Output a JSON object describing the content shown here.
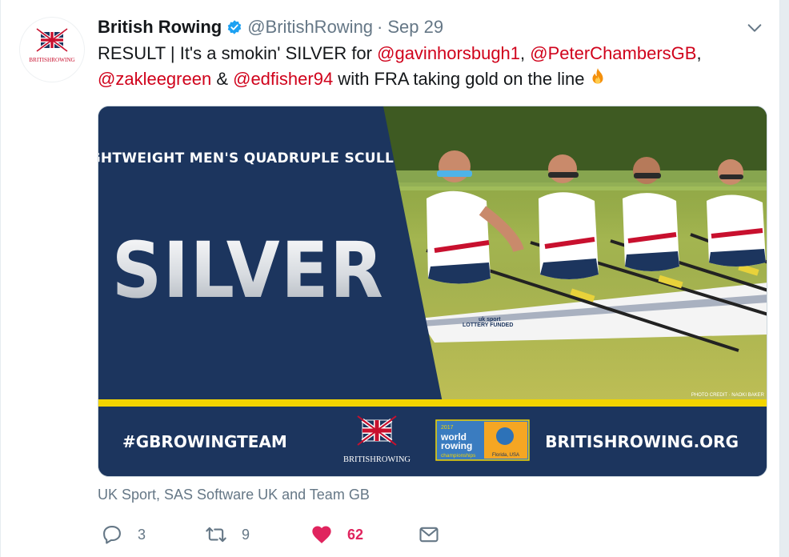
{
  "tweet": {
    "author_name": "British Rowing",
    "handle": "@BritishRowing",
    "separator": "·",
    "time": "Sep 29",
    "text_parts": {
      "p1": "RESULT | It's a smokin' SILVER for ",
      "m1": "@gavinhorsbugh1",
      "p2": ", ",
      "m2": "@PeterChambersGB",
      "p3": ",",
      "m3": "@zakleegreen",
      "p4": " & ",
      "m4": "@edfisher94",
      "p5": " with FRA taking gold on the line"
    },
    "avatar_logo_text": "BRITISHROWING"
  },
  "media": {
    "event_title": "LIGHTWEIGHT MEN'S QUADRUPLE SCULL",
    "medal_text": "SILVER",
    "hashtag": "#GBROWINGTEAM",
    "center_logo_text": "BRITISHROWING",
    "wrc_year": "2017",
    "wrc_line1": "world",
    "wrc_line2": "rowing",
    "wrc_line3": "championships",
    "wrc_location": "Florida, USA",
    "website": "BRITISHROWING.ORG",
    "photo_credit": "PHOTO CREDIT · NAOKI BAKER",
    "boat_text1": "LOTTERY FUNDED",
    "boat_text2": "uk sport",
    "colors": {
      "navy": "#1c355e",
      "yellow": "#f2d400",
      "brand_red": "#c8102e"
    }
  },
  "tagged_text": "UK Sport, SAS Software UK and Team GB",
  "actions": {
    "reply_count": "3",
    "retweet_count": "9",
    "like_count": "62",
    "like_color": "#e0245e"
  },
  "icons": [
    "verified-icon",
    "caret-down-icon",
    "fire-emoji-icon",
    "reply-icon",
    "retweet-icon",
    "heart-icon",
    "message-icon"
  ]
}
